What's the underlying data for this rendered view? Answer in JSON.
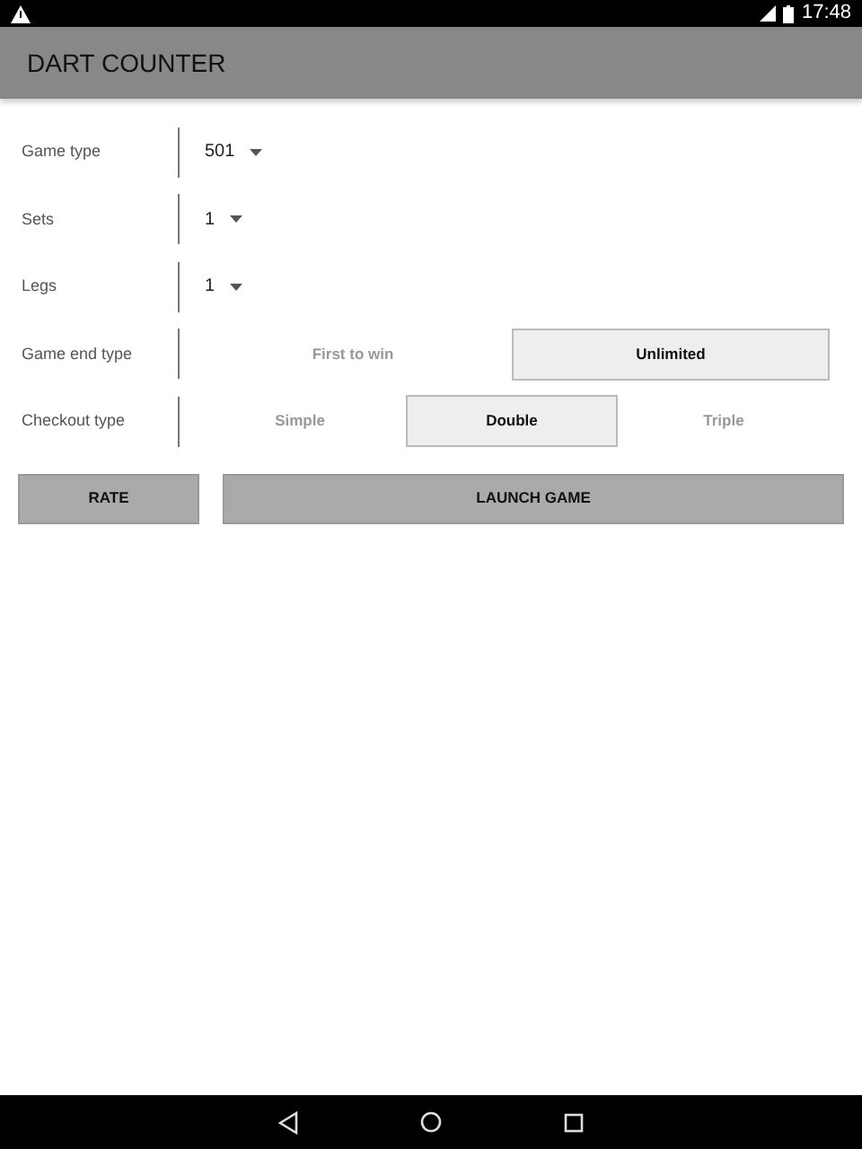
{
  "status_bar": {
    "time": "17:48"
  },
  "app_bar": {
    "title": "DART COUNTER"
  },
  "settings": [
    {
      "label": "Game type",
      "kind": "dropdown",
      "value": "501"
    },
    {
      "label": "Sets",
      "kind": "dropdown",
      "value": "1"
    },
    {
      "label": "Legs",
      "kind": "dropdown",
      "value": "1"
    },
    {
      "label": "Game end type",
      "kind": "segmented",
      "options": [
        {
          "label": "First to win",
          "selected": false
        },
        {
          "label": "Unlimited",
          "selected": true
        }
      ]
    },
    {
      "label": "Checkout type",
      "kind": "segmented",
      "options": [
        {
          "label": "Simple",
          "selected": false
        },
        {
          "label": "Double",
          "selected": true
        },
        {
          "label": "Triple",
          "selected": false
        }
      ]
    }
  ],
  "buttons": [
    {
      "label": "RATE"
    },
    {
      "label": "LAUNCH GAME"
    }
  ]
}
